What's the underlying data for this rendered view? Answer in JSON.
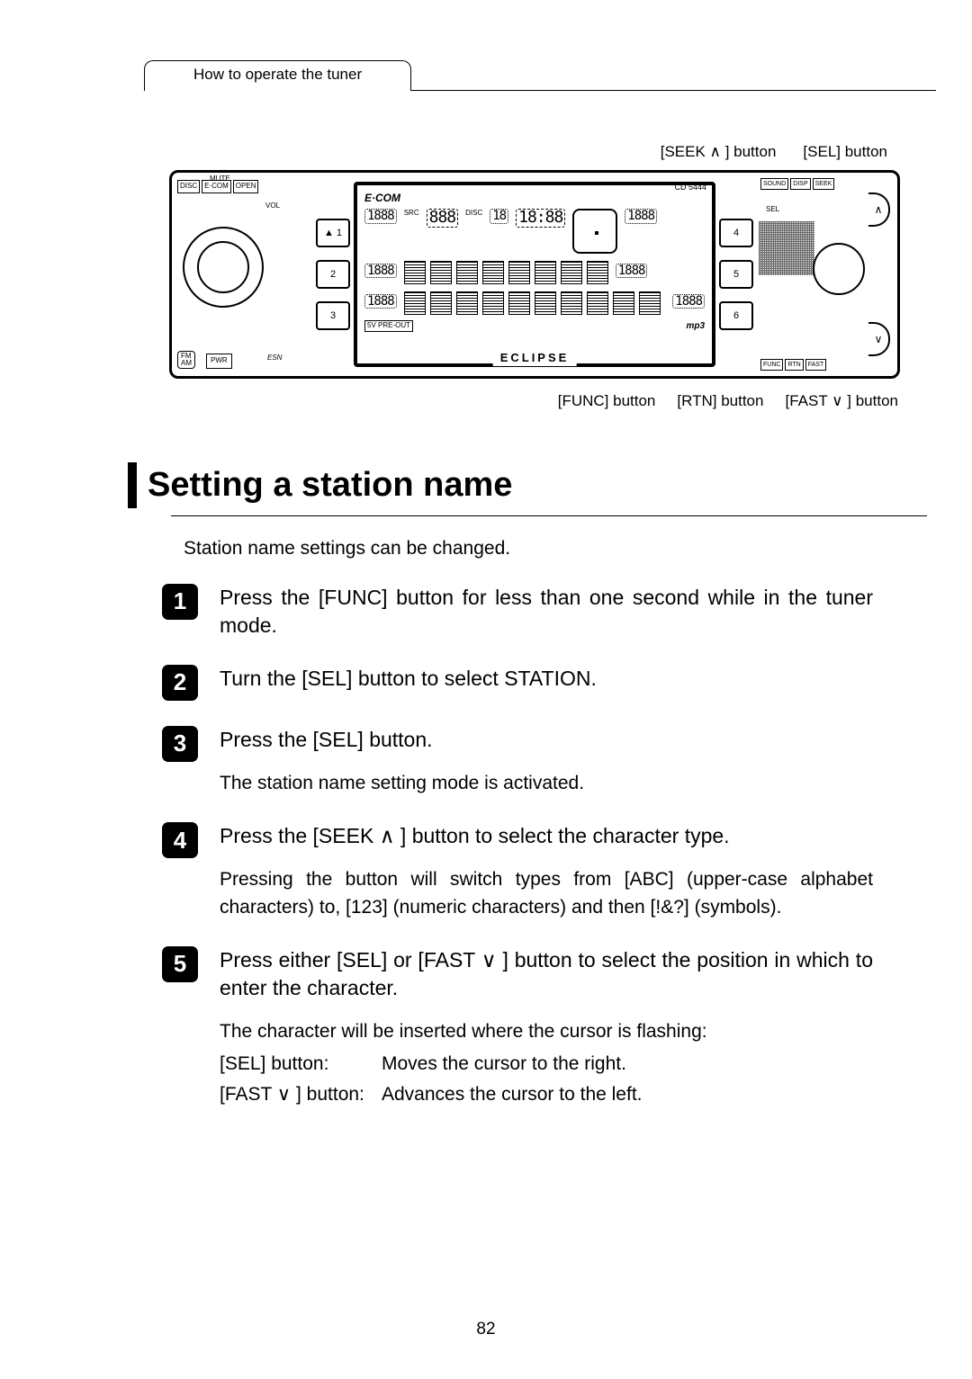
{
  "header": {
    "tab_label": "How to operate the tuner"
  },
  "diagram": {
    "callout_seek": "[SEEK ∧ ] button",
    "callout_sel": "[SEL] button",
    "callout_func": "[FUNC] button",
    "callout_rtn": "[RTN] button",
    "callout_fast": "[FAST ∨ ] button",
    "panel": {
      "mute": "MUTE",
      "disc": "DISC",
      "ecom_tab": "E·COM",
      "open_tab": "OPEN",
      "vol": "VOL",
      "fm_am": "FM\nAM",
      "pwr": "PWR",
      "esn": "ESN",
      "brand_title": "E·COM",
      "cd_model": "CD 5444",
      "preset_left_1": "▲  1",
      "preset_left_2": "2",
      "preset_left_3": "3",
      "preset_right_4": "4",
      "preset_right_5": "5",
      "preset_right_6": "6",
      "preout": "5V PRE-OUT",
      "mp3": "mp3",
      "brand_footer": "ECLIPSE",
      "sound_tab": "SOUND",
      "disp_tab": "DISP",
      "seek_tab": "SEEK",
      "sel_label": "SEL",
      "func_tab": "FUNC",
      "rtn_tab": "RTN",
      "fast_tab": "FAST",
      "arc_up": "∧",
      "arc_down": "∨",
      "seg_digits_1": "1888",
      "seg_digits_2": "1888",
      "seg_digits_3": "1888",
      "seg_time": "18:88",
      "seg_src": "SRC",
      "seg_888": "888",
      "seg_disc": "DISC",
      "seg_18": "18"
    }
  },
  "section_title": "Setting a station name",
  "intro_text": "Station name settings can be changed.",
  "steps": [
    {
      "num": "1",
      "title": "Press the [FUNC] button for less than one second while in the tuner mode."
    },
    {
      "num": "2",
      "title": "Turn the [SEL] button to select STATION."
    },
    {
      "num": "3",
      "title": "Press the [SEL] button.",
      "desc": "The station name setting mode is activated."
    },
    {
      "num": "4",
      "title": "Press the [SEEK ∧ ] button to select the character type.",
      "desc": "Pressing the button will switch types from [ABC] (upper-case alphabet characters) to, [123] (numeric characters) and then [!&?] (symbols)."
    },
    {
      "num": "5",
      "title": "Press either [SEL] or [FAST ∨ ] button to select the position in which to enter the character.",
      "desc_intro": "The character will be inserted where the cursor is flashing:",
      "rows": [
        {
          "k": "[SEL] button:",
          "v": "Moves the cursor to the right."
        },
        {
          "k": "[FAST ∨ ] button:",
          "v": "Advances the cursor to the left."
        }
      ]
    }
  ],
  "page_number": "82"
}
